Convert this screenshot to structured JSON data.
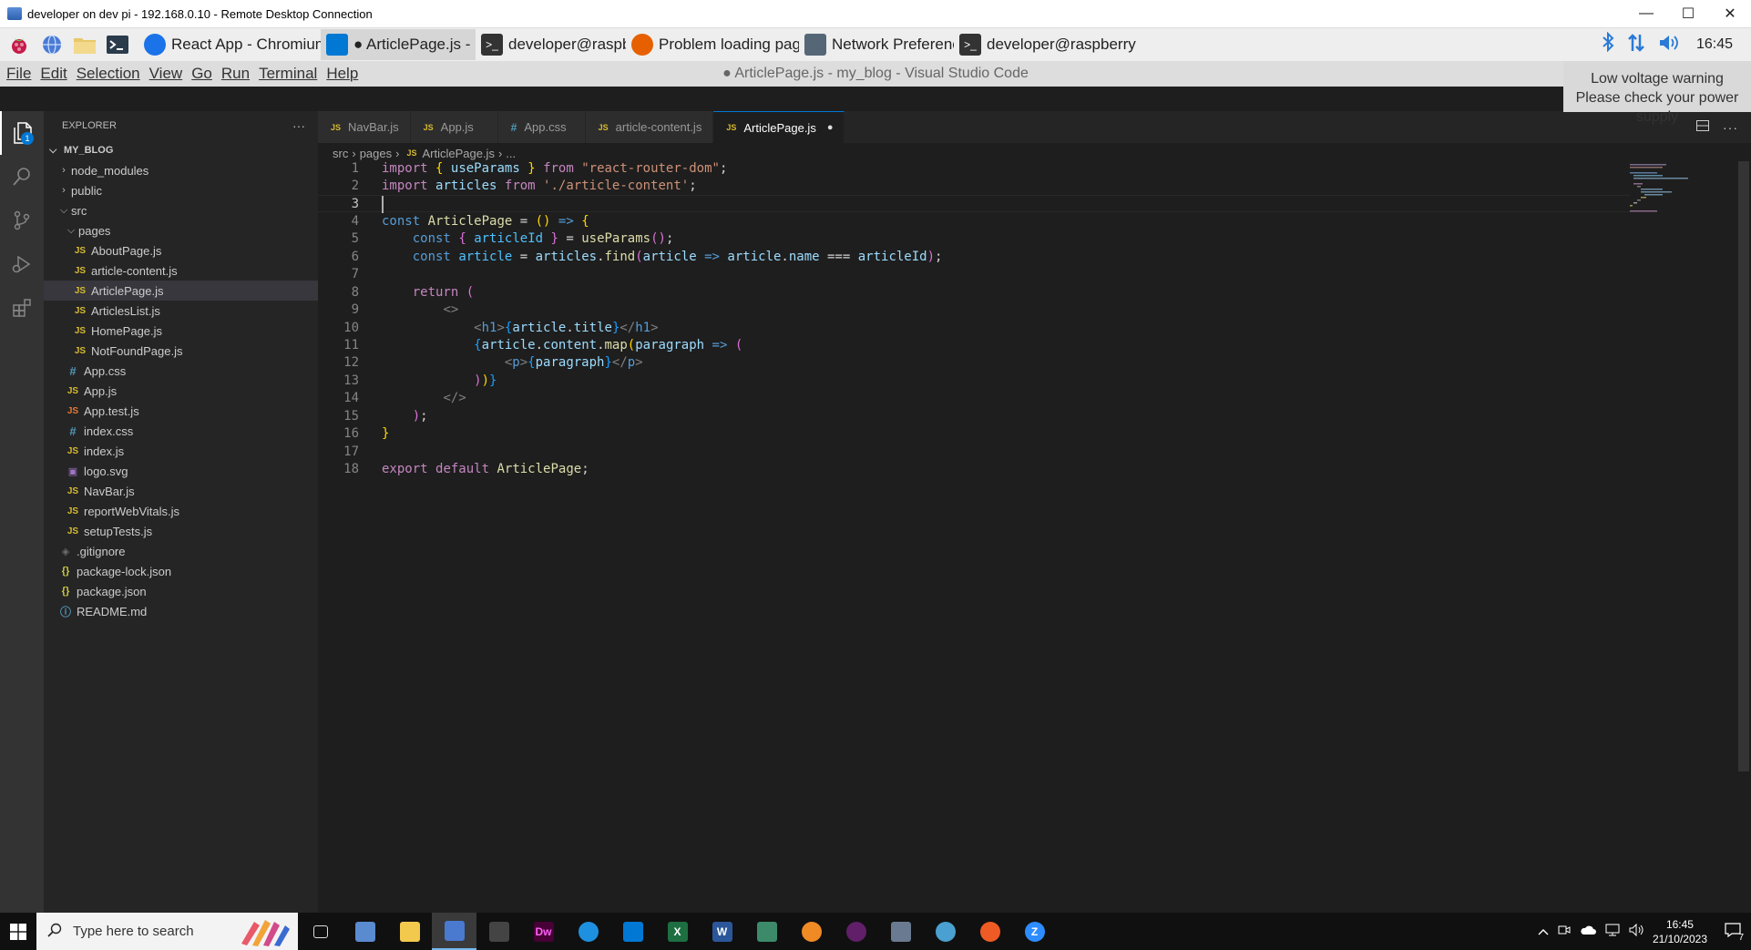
{
  "rdp": {
    "title": "developer on dev pi - 192.168.0.10 - Remote Desktop Connection",
    "minimize": "—",
    "maximize": "☐",
    "close": "✕"
  },
  "pi_taskbar": {
    "tasks": [
      {
        "label": "React App - Chromium",
        "icon": "chromium-icon",
        "color": "#1a73e8"
      },
      {
        "label": "● ArticlePage.js - my...",
        "icon": "vscode-icon",
        "color": "#0078d4"
      },
      {
        "label": "developer@raspberry...",
        "icon": "terminal-icon",
        "color": "#333333"
      },
      {
        "label": "Problem loading pag...",
        "icon": "firefox-icon",
        "color": "#e66000"
      },
      {
        "label": "Network Preferences",
        "icon": "network-icon",
        "color": "#556677"
      },
      {
        "label": "developer@raspberry...",
        "icon": "terminal-icon",
        "color": "#333333"
      }
    ],
    "clock": "16:45"
  },
  "vscode": {
    "menu": [
      "File",
      "Edit",
      "Selection",
      "View",
      "Go",
      "Run",
      "Terminal",
      "Help"
    ],
    "window_title": "● ArticlePage.js - my_blog - Visual Studio Code",
    "voltage_line1": "Low voltage warning",
    "voltage_line2": "Please check your power supply",
    "explorer_label": "EXPLORER",
    "explorer_more": "···",
    "root": "MY_BLOG",
    "badge": "1",
    "tree": [
      {
        "label": "node_modules",
        "type": "folder",
        "depth": 1,
        "open": false
      },
      {
        "label": "public",
        "type": "folder",
        "depth": 1,
        "open": false
      },
      {
        "label": "src",
        "type": "folder",
        "depth": 1,
        "open": true
      },
      {
        "label": "pages",
        "type": "folder",
        "depth": 2,
        "open": true
      },
      {
        "label": "AboutPage.js",
        "type": "js",
        "depth": 3
      },
      {
        "label": "article-content.js",
        "type": "js",
        "depth": 3
      },
      {
        "label": "ArticlePage.js",
        "type": "js",
        "depth": 3,
        "selected": true
      },
      {
        "label": "ArticlesList.js",
        "type": "js",
        "depth": 3
      },
      {
        "label": "HomePage.js",
        "type": "js",
        "depth": 3
      },
      {
        "label": "NotFoundPage.js",
        "type": "js",
        "depth": 3
      },
      {
        "label": "App.css",
        "type": "css",
        "depth": 2
      },
      {
        "label": "App.js",
        "type": "js",
        "depth": 2
      },
      {
        "label": "App.test.js",
        "type": "test",
        "depth": 2
      },
      {
        "label": "index.css",
        "type": "css",
        "depth": 2
      },
      {
        "label": "index.js",
        "type": "js",
        "depth": 2
      },
      {
        "label": "logo.svg",
        "type": "svg",
        "depth": 2
      },
      {
        "label": "NavBar.js",
        "type": "js",
        "depth": 2
      },
      {
        "label": "reportWebVitals.js",
        "type": "js",
        "depth": 2
      },
      {
        "label": "setupTests.js",
        "type": "js",
        "depth": 2
      },
      {
        "label": ".gitignore",
        "type": "git",
        "depth": 1
      },
      {
        "label": "package-lock.json",
        "type": "json",
        "depth": 1
      },
      {
        "label": "package.json",
        "type": "json",
        "depth": 1
      },
      {
        "label": "README.md",
        "type": "info",
        "depth": 1
      }
    ],
    "tabs": [
      {
        "label": "NavBar.js",
        "type": "js"
      },
      {
        "label": "App.js",
        "type": "js"
      },
      {
        "label": "App.css",
        "type": "css"
      },
      {
        "label": "article-content.js",
        "type": "js"
      },
      {
        "label": "ArticlePage.js",
        "type": "js",
        "active": true,
        "dirty": true
      }
    ],
    "breadcrumb": {
      "part1": "src",
      "part2": "pages",
      "part3": "ArticlePage.js",
      "part4": "..."
    },
    "current_line": 3,
    "code": [
      [
        [
          "kw",
          "import"
        ],
        [
          "pl",
          " "
        ],
        [
          "br1",
          "{"
        ],
        [
          "pl",
          " "
        ],
        [
          "vr",
          "useParams"
        ],
        [
          "pl",
          " "
        ],
        [
          "br1",
          "}"
        ],
        [
          "pl",
          " "
        ],
        [
          "kw",
          "from"
        ],
        [
          "pl",
          " "
        ],
        [
          "st",
          "\"react-router-dom\""
        ],
        [
          "pl",
          ";"
        ]
      ],
      [
        [
          "kw",
          "import"
        ],
        [
          "pl",
          " "
        ],
        [
          "vr",
          "articles"
        ],
        [
          "pl",
          " "
        ],
        [
          "kw",
          "from"
        ],
        [
          "pl",
          " "
        ],
        [
          "st",
          "'./article-content'"
        ],
        [
          "pl",
          ";"
        ]
      ],
      [],
      [
        [
          "dk",
          "const"
        ],
        [
          "pl",
          " "
        ],
        [
          "fn",
          "ArticlePage"
        ],
        [
          "pl",
          " = "
        ],
        [
          "br1",
          "()"
        ],
        [
          "pl",
          " "
        ],
        [
          "dk",
          "=>"
        ],
        [
          "pl",
          " "
        ],
        [
          "br1",
          "{"
        ]
      ],
      [
        [
          "pl",
          "    "
        ],
        [
          "dk",
          "const"
        ],
        [
          "pl",
          " "
        ],
        [
          "br2",
          "{"
        ],
        [
          "pl",
          " "
        ],
        [
          "cons",
          "articleId"
        ],
        [
          "pl",
          " "
        ],
        [
          "br2",
          "}"
        ],
        [
          "pl",
          " = "
        ],
        [
          "fn",
          "useParams"
        ],
        [
          "br2",
          "()"
        ],
        [
          "pl",
          ";"
        ]
      ],
      [
        [
          "pl",
          "    "
        ],
        [
          "dk",
          "const"
        ],
        [
          "pl",
          " "
        ],
        [
          "cons",
          "article"
        ],
        [
          "pl",
          " = "
        ],
        [
          "vr",
          "articles"
        ],
        [
          "pl",
          "."
        ],
        [
          "fn",
          "find"
        ],
        [
          "br2",
          "("
        ],
        [
          "vr",
          "article"
        ],
        [
          "pl",
          " "
        ],
        [
          "dk",
          "=>"
        ],
        [
          "pl",
          " "
        ],
        [
          "vr",
          "article"
        ],
        [
          "pl",
          "."
        ],
        [
          "vr",
          "name"
        ],
        [
          "pl",
          " === "
        ],
        [
          "vr",
          "articleId"
        ],
        [
          "br2",
          ")"
        ],
        [
          "pl",
          ";"
        ]
      ],
      [],
      [
        [
          "pl",
          "    "
        ],
        [
          "kw",
          "return"
        ],
        [
          "pl",
          " "
        ],
        [
          "br2",
          "("
        ]
      ],
      [
        [
          "pl",
          "        "
        ],
        [
          "tg",
          "<>"
        ]
      ],
      [
        [
          "pl",
          "            "
        ],
        [
          "tg",
          "<"
        ],
        [
          "dk",
          "h1"
        ],
        [
          "tg",
          ">"
        ],
        [
          "br3",
          "{"
        ],
        [
          "vr",
          "article"
        ],
        [
          "pl",
          "."
        ],
        [
          "vr",
          "title"
        ],
        [
          "br3",
          "}"
        ],
        [
          "tg",
          "</"
        ],
        [
          "dk",
          "h1"
        ],
        [
          "tg",
          ">"
        ]
      ],
      [
        [
          "pl",
          "            "
        ],
        [
          "br3",
          "{"
        ],
        [
          "vr",
          "article"
        ],
        [
          "pl",
          "."
        ],
        [
          "vr",
          "content"
        ],
        [
          "pl",
          "."
        ],
        [
          "fn",
          "map"
        ],
        [
          "br1",
          "("
        ],
        [
          "vr",
          "paragraph"
        ],
        [
          "pl",
          " "
        ],
        [
          "dk",
          "=>"
        ],
        [
          "pl",
          " "
        ],
        [
          "br2",
          "("
        ]
      ],
      [
        [
          "pl",
          "                "
        ],
        [
          "tg",
          "<"
        ],
        [
          "dk",
          "p"
        ],
        [
          "tg",
          ">"
        ],
        [
          "br3",
          "{"
        ],
        [
          "vr",
          "paragraph"
        ],
        [
          "br3",
          "}"
        ],
        [
          "tg",
          "</"
        ],
        [
          "dk",
          "p"
        ],
        [
          "tg",
          ">"
        ]
      ],
      [
        [
          "pl",
          "            "
        ],
        [
          "br2",
          ")"
        ],
        [
          "br1",
          ")"
        ],
        [
          "br3",
          "}"
        ]
      ],
      [
        [
          "pl",
          "        "
        ],
        [
          "tg",
          "</>"
        ]
      ],
      [
        [
          "pl",
          "    "
        ],
        [
          "br2",
          ")"
        ],
        [
          "pl",
          ";"
        ]
      ],
      [
        [
          "br1",
          "}"
        ]
      ],
      [],
      [
        [
          "kw",
          "export"
        ],
        [
          "pl",
          " "
        ],
        [
          "kw",
          "default"
        ],
        [
          "pl",
          " "
        ],
        [
          "fn",
          "ArticlePage"
        ],
        [
          "pl",
          ";"
        ]
      ]
    ]
  },
  "win_taskbar": {
    "search_placeholder": "Type here to search",
    "time": "16:45",
    "date": "21/10/2023",
    "notifications": "7",
    "apps": [
      {
        "name": "task-view-icon"
      },
      {
        "name": "remote-desktop-icon"
      },
      {
        "name": "file-explorer-icon"
      },
      {
        "name": "rdp-active-icon",
        "active": true
      },
      {
        "name": "terminal-icon"
      },
      {
        "name": "dreamweaver-icon",
        "text": "Dw"
      },
      {
        "name": "edge-icon"
      },
      {
        "name": "vscode-icon"
      },
      {
        "name": "excel-icon",
        "text": "X"
      },
      {
        "name": "word-icon",
        "text": "W"
      },
      {
        "name": "network-icon"
      },
      {
        "name": "app-orange-icon"
      },
      {
        "name": "slack-icon"
      },
      {
        "name": "remote-app-icon"
      },
      {
        "name": "paint-icon"
      },
      {
        "name": "postman-icon"
      },
      {
        "name": "zoom-icon",
        "text": "Z"
      }
    ]
  }
}
